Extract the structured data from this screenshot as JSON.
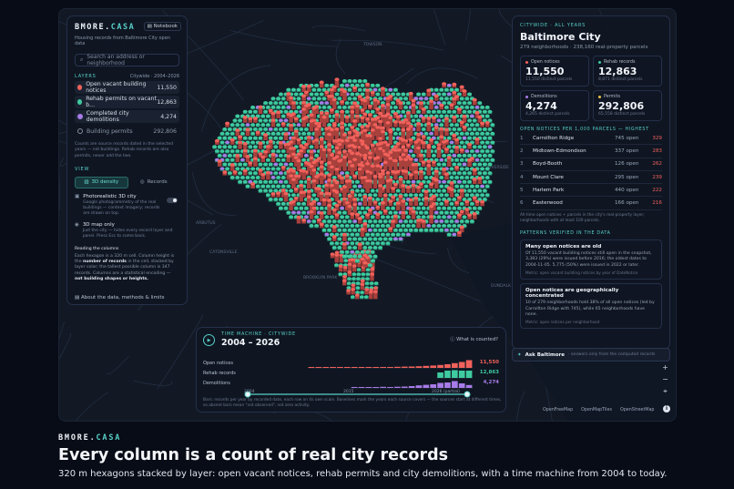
{
  "colors": {
    "vacant": "#f2615b",
    "rehab": "#3ecb9f",
    "demolition": "#a77be8",
    "building": "#8a8f99",
    "accent": "#58d0c7"
  },
  "left_panel": {
    "brand_a": "BMORE.",
    "brand_b": "CASA",
    "notebook": "Notebook",
    "subtitle": "Housing records from Baltimore City open data",
    "search_placeholder": "Search an address or neighborhood",
    "layers_heading": "LAYERS",
    "layers_range": "Citywide · 2004–2026",
    "layers": [
      {
        "label": "Open vacant building notices",
        "value": "11,550"
      },
      {
        "label": "Rehab permits on vacant b...",
        "value": "12,863"
      },
      {
        "label": "Completed city demolitions",
        "value": "4,274"
      },
      {
        "label": "Building permits",
        "value": "292,806"
      }
    ],
    "layers_note": "Counts are source records dated in the selected years — not buildings. Rehab records are also permits, never add the two.",
    "view_heading": "VIEW",
    "tab_3d": "3D density",
    "tab_records": "Records",
    "photo_title": "Photorealistic 3D city",
    "photo_desc": "Google photogrammetry of the real buildings — context imagery; records are drawn on top.",
    "map_only_title": "3D map only",
    "map_only_desc": "Just the city — hides every record layer and panel. Press Esc to come back.",
    "reading_title": "Reading the columns",
    "reading_a": "Each hexagon is a 320 m cell. Column height is the ",
    "reading_b": "number of records",
    "reading_c": " in the cell, stacked by layer color; the tallest possible column is 347 records. Columns are a statistical encoding — ",
    "reading_d": "not building shapes or heights.",
    "about": "About the data, methods & limits"
  },
  "right_panel": {
    "scope": "CITYWIDE · ALL YEARS",
    "city": "Baltimore City",
    "city_sub": "279 neighborhoods · 238,160 real-property parcels",
    "kpis": [
      {
        "label": "Open notices",
        "value": "11,550",
        "sub": "11,550 distinct parcels"
      },
      {
        "label": "Rehab records",
        "value": "12,863",
        "sub": "8,871 distinct parcels"
      },
      {
        "label": "Demolitions",
        "value": "4,274",
        "sub": "4,265 distinct parcels"
      },
      {
        "label": "Permits",
        "value": "292,806",
        "sub": "65,558 distinct parcels"
      }
    ],
    "rank_heading": "OPEN NOTICES PER 1,000 PARCELS — HIGHEST",
    "ranks": [
      {
        "n": "1",
        "name": "Carrollton Ridge",
        "open": "745 open",
        "count": "329"
      },
      {
        "n": "2",
        "name": "Midtown-Edmondson",
        "open": "337 open",
        "count": "283"
      },
      {
        "n": "3",
        "name": "Boyd-Booth",
        "open": "126 open",
        "count": "262"
      },
      {
        "n": "4",
        "name": "Mount Clare",
        "open": "295 open",
        "count": "239"
      },
      {
        "n": "5",
        "name": "Harlem Park",
        "open": "440 open",
        "count": "222"
      },
      {
        "n": "6",
        "name": "Easterwood",
        "open": "166 open",
        "count": "216"
      }
    ],
    "rank_note": "All-time open notices ÷ parcels in the city's real-property layer; neighborhoods with at least 100 parcels.",
    "patterns_heading": "PATTERNS VERIFIED IN THE DATA",
    "patterns": [
      {
        "title": "Many open notices are old",
        "body": "Of 11,550 vacant building notices still open in the snapshot, 3,383 (29%) were issued before 2016; the oldest dates to 2004-11-05. 5,775 (50%) were issued in 2022 or later.",
        "meta": "Metric: open vacant building notices by year of DateNotice"
      },
      {
        "title": "Open notices are geographically concentrated",
        "body": "10 of 279 neighborhoods hold 38% of all open notices (led by Carrollton Ridge with 745), while 65 neighborhoods have none.",
        "meta": "Metric: open notices per neighborhood"
      }
    ]
  },
  "ask": {
    "label": "Ask Baltimore",
    "hint": "· answers only from the computed records"
  },
  "zoom": {
    "in": "+",
    "out": "−",
    "reset": "⌖"
  },
  "attribution": [
    "OpenFreeMap",
    "OpenMapTiles",
    "OpenStreetMap"
  ],
  "map_labels": [
    "ARBUTUS",
    "CATONSVILLE",
    "BROOKLYN PARK",
    "DUNDALK",
    "DOVER",
    "RIVERSIDE",
    "TOWSON"
  ],
  "time_machine": {
    "heading": "TIME MACHINE · CITYWIDE",
    "range": "2004 – 2026",
    "what": "What is counted?",
    "rows": [
      {
        "label": "Open notices",
        "value": "11,550"
      },
      {
        "label": "Rehab records",
        "value": "12,863"
      },
      {
        "label": "Demolitions",
        "value": "4,274"
      }
    ],
    "ticks": [
      "2004",
      "2015",
      "2026 (partial)"
    ],
    "note": "Bars: records per year by recorded date, each row on its own scale. Baselines mark the years each source covers — the sources start at different times, so absent bars mean \"not observed\", not zero activity."
  },
  "footer": {
    "brand_a": "BMORE.",
    "brand_b": "CASA",
    "title": "Every column is a count of real city records",
    "subtitle": "320 m hexagons stacked by layer: open vacant notices, rehab permits and city demolitions, with a time machine from 2004 to today."
  }
}
